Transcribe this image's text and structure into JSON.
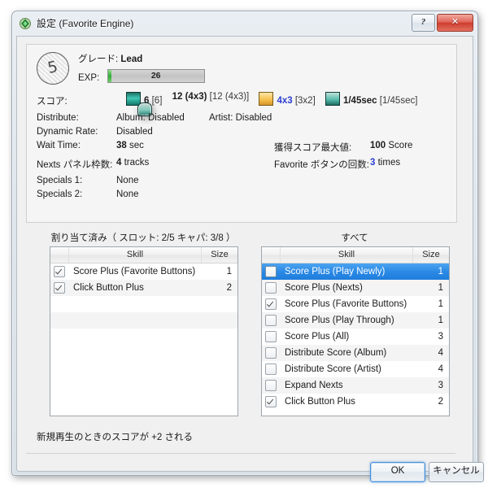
{
  "window": {
    "title_main": "設定",
    "title_sub": "(Favorite Engine)",
    "icon": "green-diamond-icon",
    "help_label": "?",
    "close_label": "✕"
  },
  "info": {
    "badge_glyph": "5",
    "grade_label": "グレード:",
    "grade_value": "Lead",
    "exp_label": "EXP:",
    "exp_value": "26",
    "score_label": "スコア:",
    "score_items": [
      {
        "icon": "play-arrow-icon",
        "value": "6",
        "bracket": "[6]"
      },
      {
        "icon": "window-arrow-icon",
        "value": "12 (4x3)",
        "bracket": "[12 (4x3)]"
      },
      {
        "icon": "star-icon",
        "value": "4x3",
        "bracket": "[3x2]",
        "accent": "blue"
      },
      {
        "icon": "swap-icon",
        "value": "1/45sec",
        "bracket": "[1/45sec]"
      }
    ],
    "rows": [
      {
        "key": "Distribute:",
        "value": "Album: Disabled",
        "value2": "Artist: Disabled",
        "key_right": "",
        "value_right": ""
      },
      {
        "key": "Dynamic Rate:",
        "value": "Disabled",
        "value2": "",
        "key_right": "",
        "value_right": ""
      },
      {
        "key": "Wait Time:",
        "value_bold": "38",
        "value_unit": "sec",
        "key_right": "獲得スコア最大値:",
        "value_right_bold": "100",
        "value_right_unit": "Score"
      },
      {
        "key": "Nexts パネル枠数:",
        "value_bold": "4",
        "value_unit": "tracks",
        "key_right": "Favorite ボタンの回数:",
        "value_right_bold": "3",
        "value_right_unit": "times",
        "right_accent": "blue"
      },
      {
        "key": "Specials 1:",
        "value": "None",
        "key_right": "",
        "value_right": ""
      },
      {
        "key": "Specials 2:",
        "value": "None",
        "key_right": "",
        "value_right": ""
      }
    ]
  },
  "assigned_panel": {
    "title": "割り当て済み（ スロット: 2/5  キャパ: 3/8 ）",
    "columns": {
      "skill": "Skill",
      "size": "Size"
    },
    "rows": [
      {
        "checked": true,
        "skill": "Score Plus (Favorite Buttons)",
        "size": "1"
      },
      {
        "checked": true,
        "skill": "Click Button Plus",
        "size": "2"
      }
    ]
  },
  "all_panel": {
    "title": "すべて",
    "columns": {
      "skill": "Skill",
      "size": "Size"
    },
    "rows": [
      {
        "checked": false,
        "selected": true,
        "skill": "Score Plus (Play Newly)",
        "size": "1"
      },
      {
        "checked": false,
        "selected": false,
        "skill": "Score Plus (Nexts)",
        "size": "1"
      },
      {
        "checked": true,
        "selected": false,
        "skill": "Score Plus (Favorite Buttons)",
        "size": "1"
      },
      {
        "checked": false,
        "selected": false,
        "skill": "Score Plus (Play Through)",
        "size": "1"
      },
      {
        "checked": false,
        "selected": false,
        "skill": "Score Plus (All)",
        "size": "3"
      },
      {
        "checked": false,
        "selected": false,
        "skill": "Distribute Score (Album)",
        "size": "4"
      },
      {
        "checked": false,
        "selected": false,
        "skill": "Distribute Score (Artist)",
        "size": "4"
      },
      {
        "checked": false,
        "selected": false,
        "skill": "Expand Nexts",
        "size": "3"
      },
      {
        "checked": true,
        "selected": false,
        "skill": "Click Button Plus",
        "size": "2"
      }
    ]
  },
  "description": "新規再生のときのスコアが +2 される",
  "footer": {
    "ok_label": "OK",
    "cancel_label": "キャンセル"
  },
  "colors": {
    "selection_blue": "#2b8ae6",
    "accent_blue": "#2b3fd0",
    "exp_green": "#35ac3a",
    "close_red": "#cf3d2e"
  }
}
